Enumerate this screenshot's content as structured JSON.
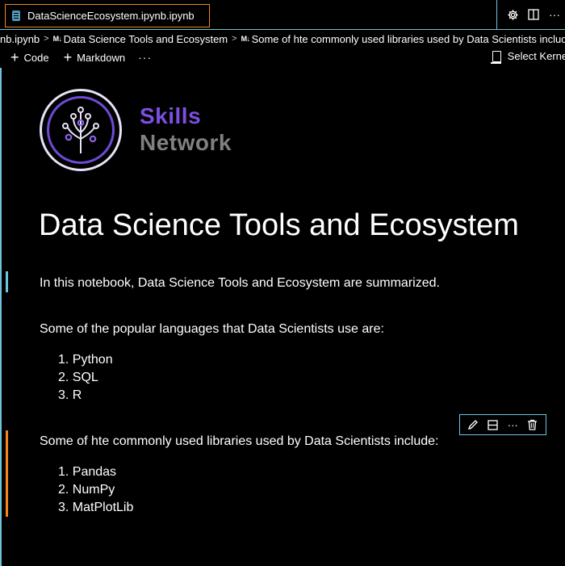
{
  "tab": {
    "title": "DataScienceEcosystem.ipynb.ipynb",
    "icon": "notebook-file-icon"
  },
  "tabbar_actions": [
    "gear-icon",
    "split-editor-icon",
    "more-icon"
  ],
  "breadcrumb": {
    "items": [
      {
        "label": "nb.ipynb"
      },
      {
        "badge": "M↓",
        "label": "Data Science Tools and Ecosystem"
      },
      {
        "badge": "M↓",
        "label": "Some of hte commonly used libraries used by Data Scientists include"
      }
    ]
  },
  "toolbar": {
    "code_label": "Code",
    "markdown_label": "Markdown",
    "more_label": "···",
    "kernel_label": "Select Kernel"
  },
  "logo": {
    "line1": "Skills",
    "line2": "Network"
  },
  "notebook": {
    "title": "Data Science Tools and Ecosystem",
    "intro": "In this notebook, Data Science Tools and Ecosystem are summarized.",
    "languages_heading": "Some of the popular languages that Data Scientists use are:",
    "languages": [
      "1. Python",
      "2. SQL",
      "3. R"
    ],
    "libraries_heading": "Some of hte commonly used libraries used by Data Scientists include:",
    "libraries": [
      "1. Pandas",
      "2. NumPy",
      "3. MatPlotLib"
    ]
  },
  "cell_toolbar": [
    "edit-pencil-icon",
    "split-cell-icon",
    "more-icon",
    "delete-trash-icon"
  ],
  "colors": {
    "focus_border": "#6fc3df",
    "active_border": "#f38518",
    "brand_purple": "#7b4fe0",
    "brand_gray": "#808080"
  }
}
